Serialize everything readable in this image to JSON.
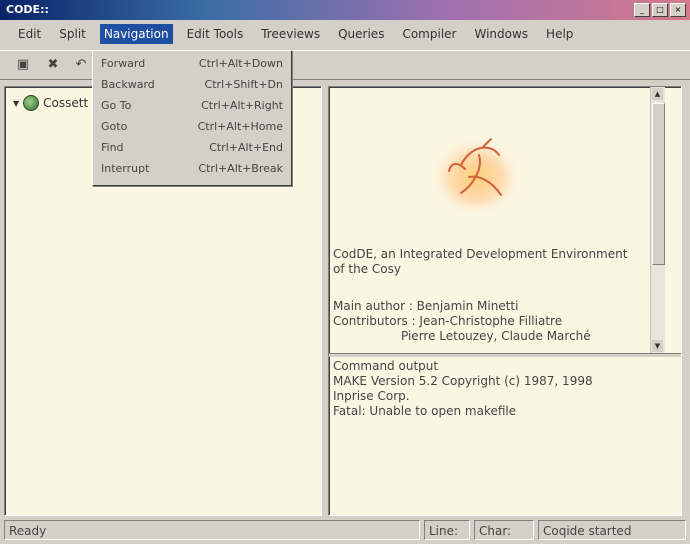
{
  "window": {
    "title": "CODE::"
  },
  "menubar": {
    "items": [
      {
        "label": "Edit",
        "active": false
      },
      {
        "label": "Split",
        "active": false
      },
      {
        "label": "Navigation",
        "active": true
      },
      {
        "label": "Edit Tools",
        "active": false
      },
      {
        "label": "Treeviews",
        "active": false
      },
      {
        "label": "Queries",
        "active": false
      },
      {
        "label": "Compiler",
        "active": false
      },
      {
        "label": "Windows",
        "active": false
      },
      {
        "label": "Help",
        "active": false
      }
    ]
  },
  "navigation_menu": {
    "items": [
      {
        "label": "Forward",
        "shortcut": "Ctrl+Alt+Down"
      },
      {
        "label": "Backward",
        "shortcut": "Ctrl+Shift+Dn"
      },
      {
        "label": "Go To",
        "shortcut": "Ctrl+Alt+Right"
      },
      {
        "label": "Goto",
        "shortcut": "Ctrl+Alt+Home"
      },
      {
        "label": "Find",
        "shortcut": "Ctrl+Alt+End"
      },
      {
        "label": "Interrupt",
        "shortcut": "Ctrl+Alt+Break"
      }
    ]
  },
  "tree": {
    "root_label": "Cossett"
  },
  "about": {
    "line1": "CodDE, an Integrated Development Environment",
    "line2": "of the Cosy",
    "author": "Main author : Benjamin Minetti",
    "contrib1": "Contributors : Jean-Christophe Filliatre",
    "contrib2": "Pierre Letouzey, Claude Marché"
  },
  "console": {
    "lines": [
      "Command output",
      "MAKE Version 5.2  Copyright (c) 1987, 1998",
      "Inprise Corp.",
      "Fatal: Unable to open makefile"
    ]
  },
  "statusbar": {
    "status": "Ready",
    "line": "Line:",
    "char": "Char:",
    "mode": "Coqide started"
  }
}
